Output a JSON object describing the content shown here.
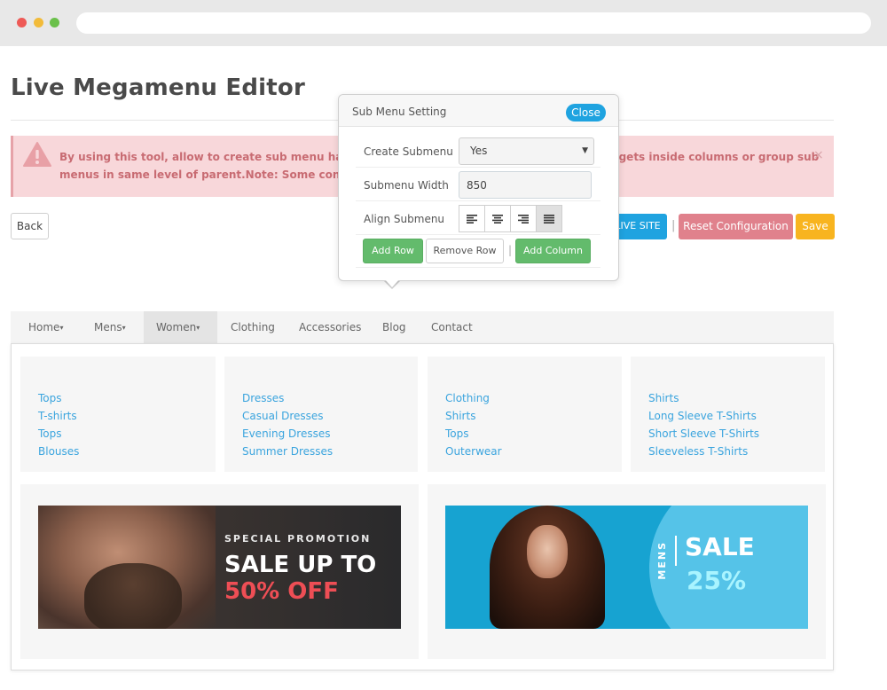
{
  "page": {
    "title": "Live Megamenu Editor"
  },
  "alert": {
    "line1_left": "By using this tool, allow to create sub menu having m",
    "line1_right": "dgets inside columns or group sub",
    "line2_left": "menus in same level of parent.Note: Some configurat",
    "line2_right": "d",
    "close": "×"
  },
  "toolbar": {
    "back_label": "Back",
    "live_site_label": "LIVE SITE",
    "separator": "|",
    "reset_label": "Reset Configuration",
    "save_label": "Save"
  },
  "popup": {
    "title": "Sub Menu Setting",
    "close_label": "Close",
    "create_submenu_label": "Create Submenu",
    "create_submenu_value": "Yes",
    "submenu_width_label": "Submenu Width",
    "submenu_width_value": "850",
    "align_submenu_label": "Align Submenu",
    "align_options": [
      "left",
      "center",
      "right",
      "justify"
    ],
    "align_selected": "justify",
    "add_row_label": "Add Row",
    "remove_row_label": "Remove Row",
    "separator": "|",
    "add_column_label": "Add Column"
  },
  "menu": {
    "items": [
      {
        "label": "Home",
        "has_caret": true
      },
      {
        "label": "Mens",
        "has_caret": true
      },
      {
        "label": "Women",
        "has_caret": true,
        "active": true
      },
      {
        "label": "Clothing",
        "has_caret": false
      },
      {
        "label": "Accessories",
        "has_caret": false
      },
      {
        "label": "Blog",
        "has_caret": false
      },
      {
        "label": "Contact",
        "has_caret": false
      }
    ],
    "caret": "▾"
  },
  "columns": [
    {
      "links": [
        "Tops",
        "T-shirts",
        "Tops",
        "Blouses"
      ]
    },
    {
      "links": [
        "Dresses",
        "Casual Dresses",
        "Evening Dresses",
        "Summer Dresses"
      ]
    },
    {
      "links": [
        "Clothing",
        "Shirts",
        "Tops",
        "Outerwear"
      ]
    },
    {
      "links": [
        "Shirts",
        "Long Sleeve T-Shirts",
        "Short Sleeve T-Shirts",
        "Sleeveless T-Shirts"
      ]
    }
  ],
  "banners": {
    "left": {
      "small": "SPECIAL PROMOTION",
      "big": "SALE UP TO",
      "highlight": "50% OFF"
    },
    "right": {
      "vertical": "MENS",
      "big": "SALE",
      "highlight": "25%"
    }
  },
  "colors": {
    "accent_blue": "#1fa3e0",
    "green": "#63bb6c",
    "reset_pink": "#e0818c",
    "save_yellow": "#f8b41f",
    "alert_bg": "#f8d7da",
    "link_blue": "#3aa4de"
  }
}
